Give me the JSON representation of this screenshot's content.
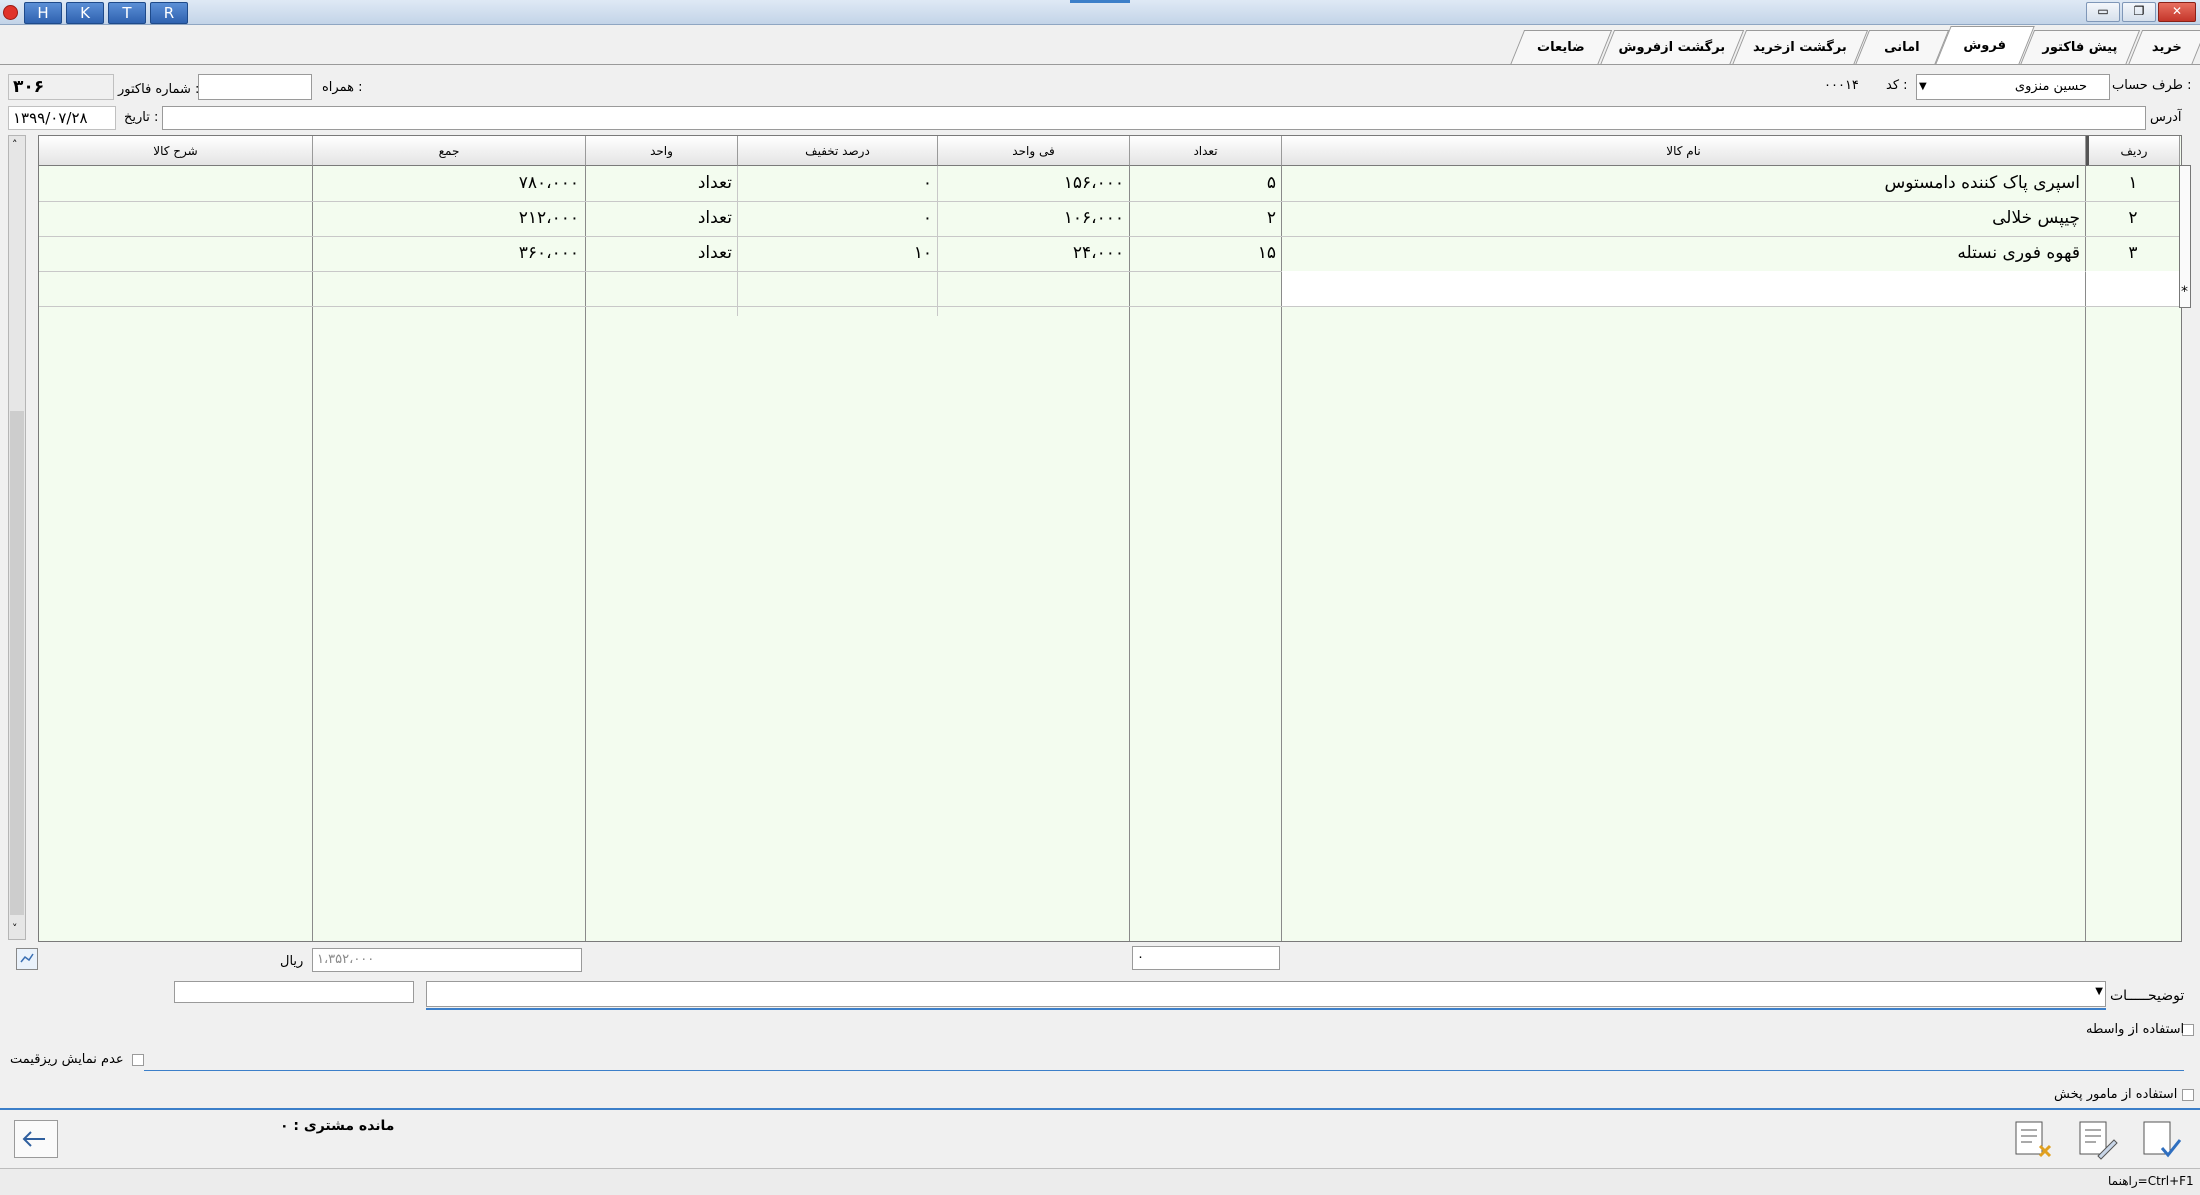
{
  "titlebar": {
    "letters": [
      "H",
      "K",
      "T",
      "R"
    ],
    "min": "▭",
    "restore": "❐",
    "close": "✕"
  },
  "tabs": [
    "خرید",
    "پیش فاکتور",
    "فروش",
    "امانی",
    "برگشت ازخرید",
    "برگشت ازفروش",
    "ضایعات"
  ],
  "active_tab": "فروش",
  "header": {
    "account_label": "طرف حساب :",
    "account_value": "حسین منزوی",
    "code_label": "کد :",
    "code_value": "۰۰۰۱۴",
    "companion_label": "همراه :",
    "companion_value": "",
    "invoice_no_label": "شماره فاکتور :",
    "invoice_no_value": "۳۰۶",
    "address_label": "آدرس",
    "address_value": "",
    "date_label": "تاریخ :",
    "date_value": "۱۳۹۹/۰۷/۲۸"
  },
  "grid": {
    "columns": [
      "ردیف",
      "نام کالا",
      "تعداد",
      "فی واحد",
      "درصد تخفیف",
      "واحد",
      "جمع",
      "شرح کالا"
    ],
    "rows": [
      {
        "idx": "۱",
        "name": "اسپری پاک کننده دامستوس",
        "qty": "۵",
        "price": "۱۵۶،۰۰۰",
        "discount": "۰",
        "unit": "تعداد",
        "total": "۷۸۰،۰۰۰",
        "desc": ""
      },
      {
        "idx": "۲",
        "name": "چیپس خلالی",
        "qty": "۲",
        "price": "۱۰۶،۰۰۰",
        "discount": "۰",
        "unit": "تعداد",
        "total": "۲۱۲،۰۰۰",
        "desc": ""
      },
      {
        "idx": "۳",
        "name": "قهوه فوری نستله",
        "qty": "۱۵",
        "price": "۲۴،۰۰۰",
        "discount": "۱۰",
        "unit": "تعداد",
        "total": "۳۶۰،۰۰۰",
        "desc": ""
      }
    ],
    "new_row_marker": "*"
  },
  "totals": {
    "qty_total": "۰",
    "sum_total": "۱،۳۵۲،۰۰۰",
    "currency": "ریال"
  },
  "footer": {
    "notes_label": "توضیحـــــات",
    "use_broker": "استفاده از واسطه",
    "hide_details": "عدم نمایش ریزقیمت",
    "use_distributor": "استفاده از مامور پخش",
    "customer_balance": "مانده مشتری : ۰",
    "help_hint": "راهنما=Ctrl+F1"
  }
}
